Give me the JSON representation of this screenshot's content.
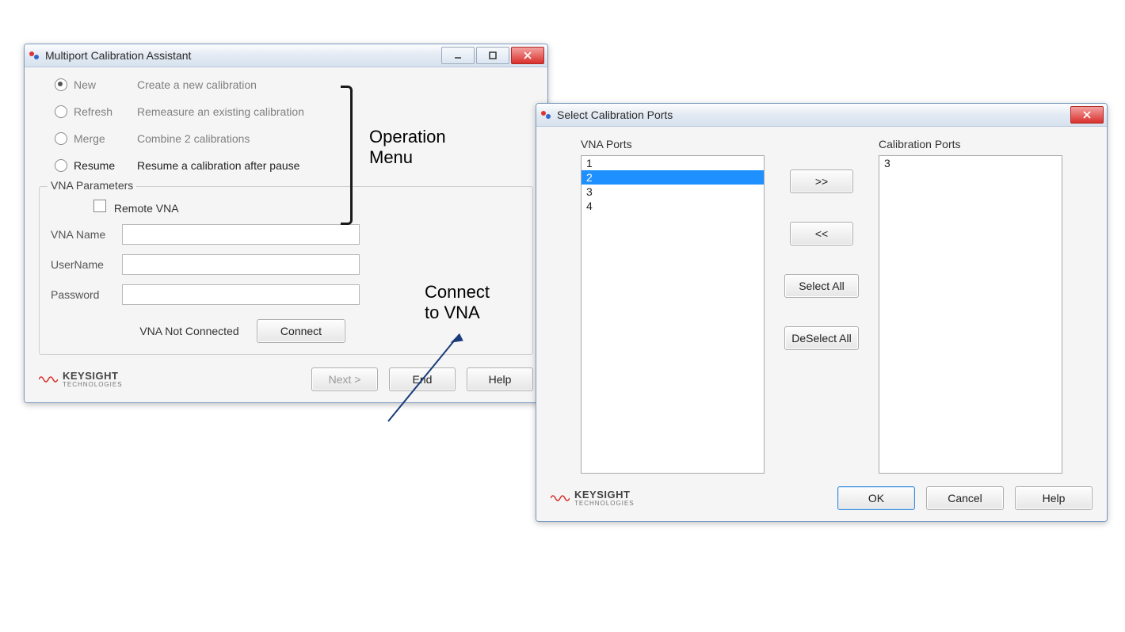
{
  "window1": {
    "title": "Multiport Calibration Assistant",
    "ops": {
      "new": {
        "label": "New",
        "desc": "Create a new calibration"
      },
      "refresh": {
        "label": "Refresh",
        "desc": "Remeasure an existing calibration"
      },
      "merge": {
        "label": "Merge",
        "desc": "Combine 2 calibrations"
      },
      "resume": {
        "label": "Resume",
        "desc": "Resume a calibration after pause"
      }
    },
    "group_title": "VNA Parameters",
    "remote_label": "Remote VNA",
    "vna_name_label": "VNA Name",
    "username_label": "UserName",
    "password_label": "Password",
    "status_text": "VNA  Not Connected",
    "connect": "Connect",
    "next": "Next >",
    "end": "End",
    "help": "Help"
  },
  "window2": {
    "title": "Select Calibration Ports",
    "vna_ports_label": "VNA Ports",
    "cal_ports_label": "Calibration Ports",
    "vna_ports": {
      "p1": "1",
      "p2": "2",
      "p3": "3",
      "p4": "4"
    },
    "cal_ports": {
      "p0": "3"
    },
    "move_right": ">>",
    "move_left": "<<",
    "select_all": "Select All",
    "deselect_all": "DeSelect All",
    "ok": "OK",
    "cancel": "Cancel",
    "help": "Help"
  },
  "annotations": {
    "operation_menu_l1": "Operation",
    "operation_menu_l2": "Menu",
    "connect_l1": "Connect",
    "connect_l2": "to VNA"
  },
  "logo": {
    "brand": "KEYSIGHT",
    "sub": "TECHNOLOGIES"
  }
}
